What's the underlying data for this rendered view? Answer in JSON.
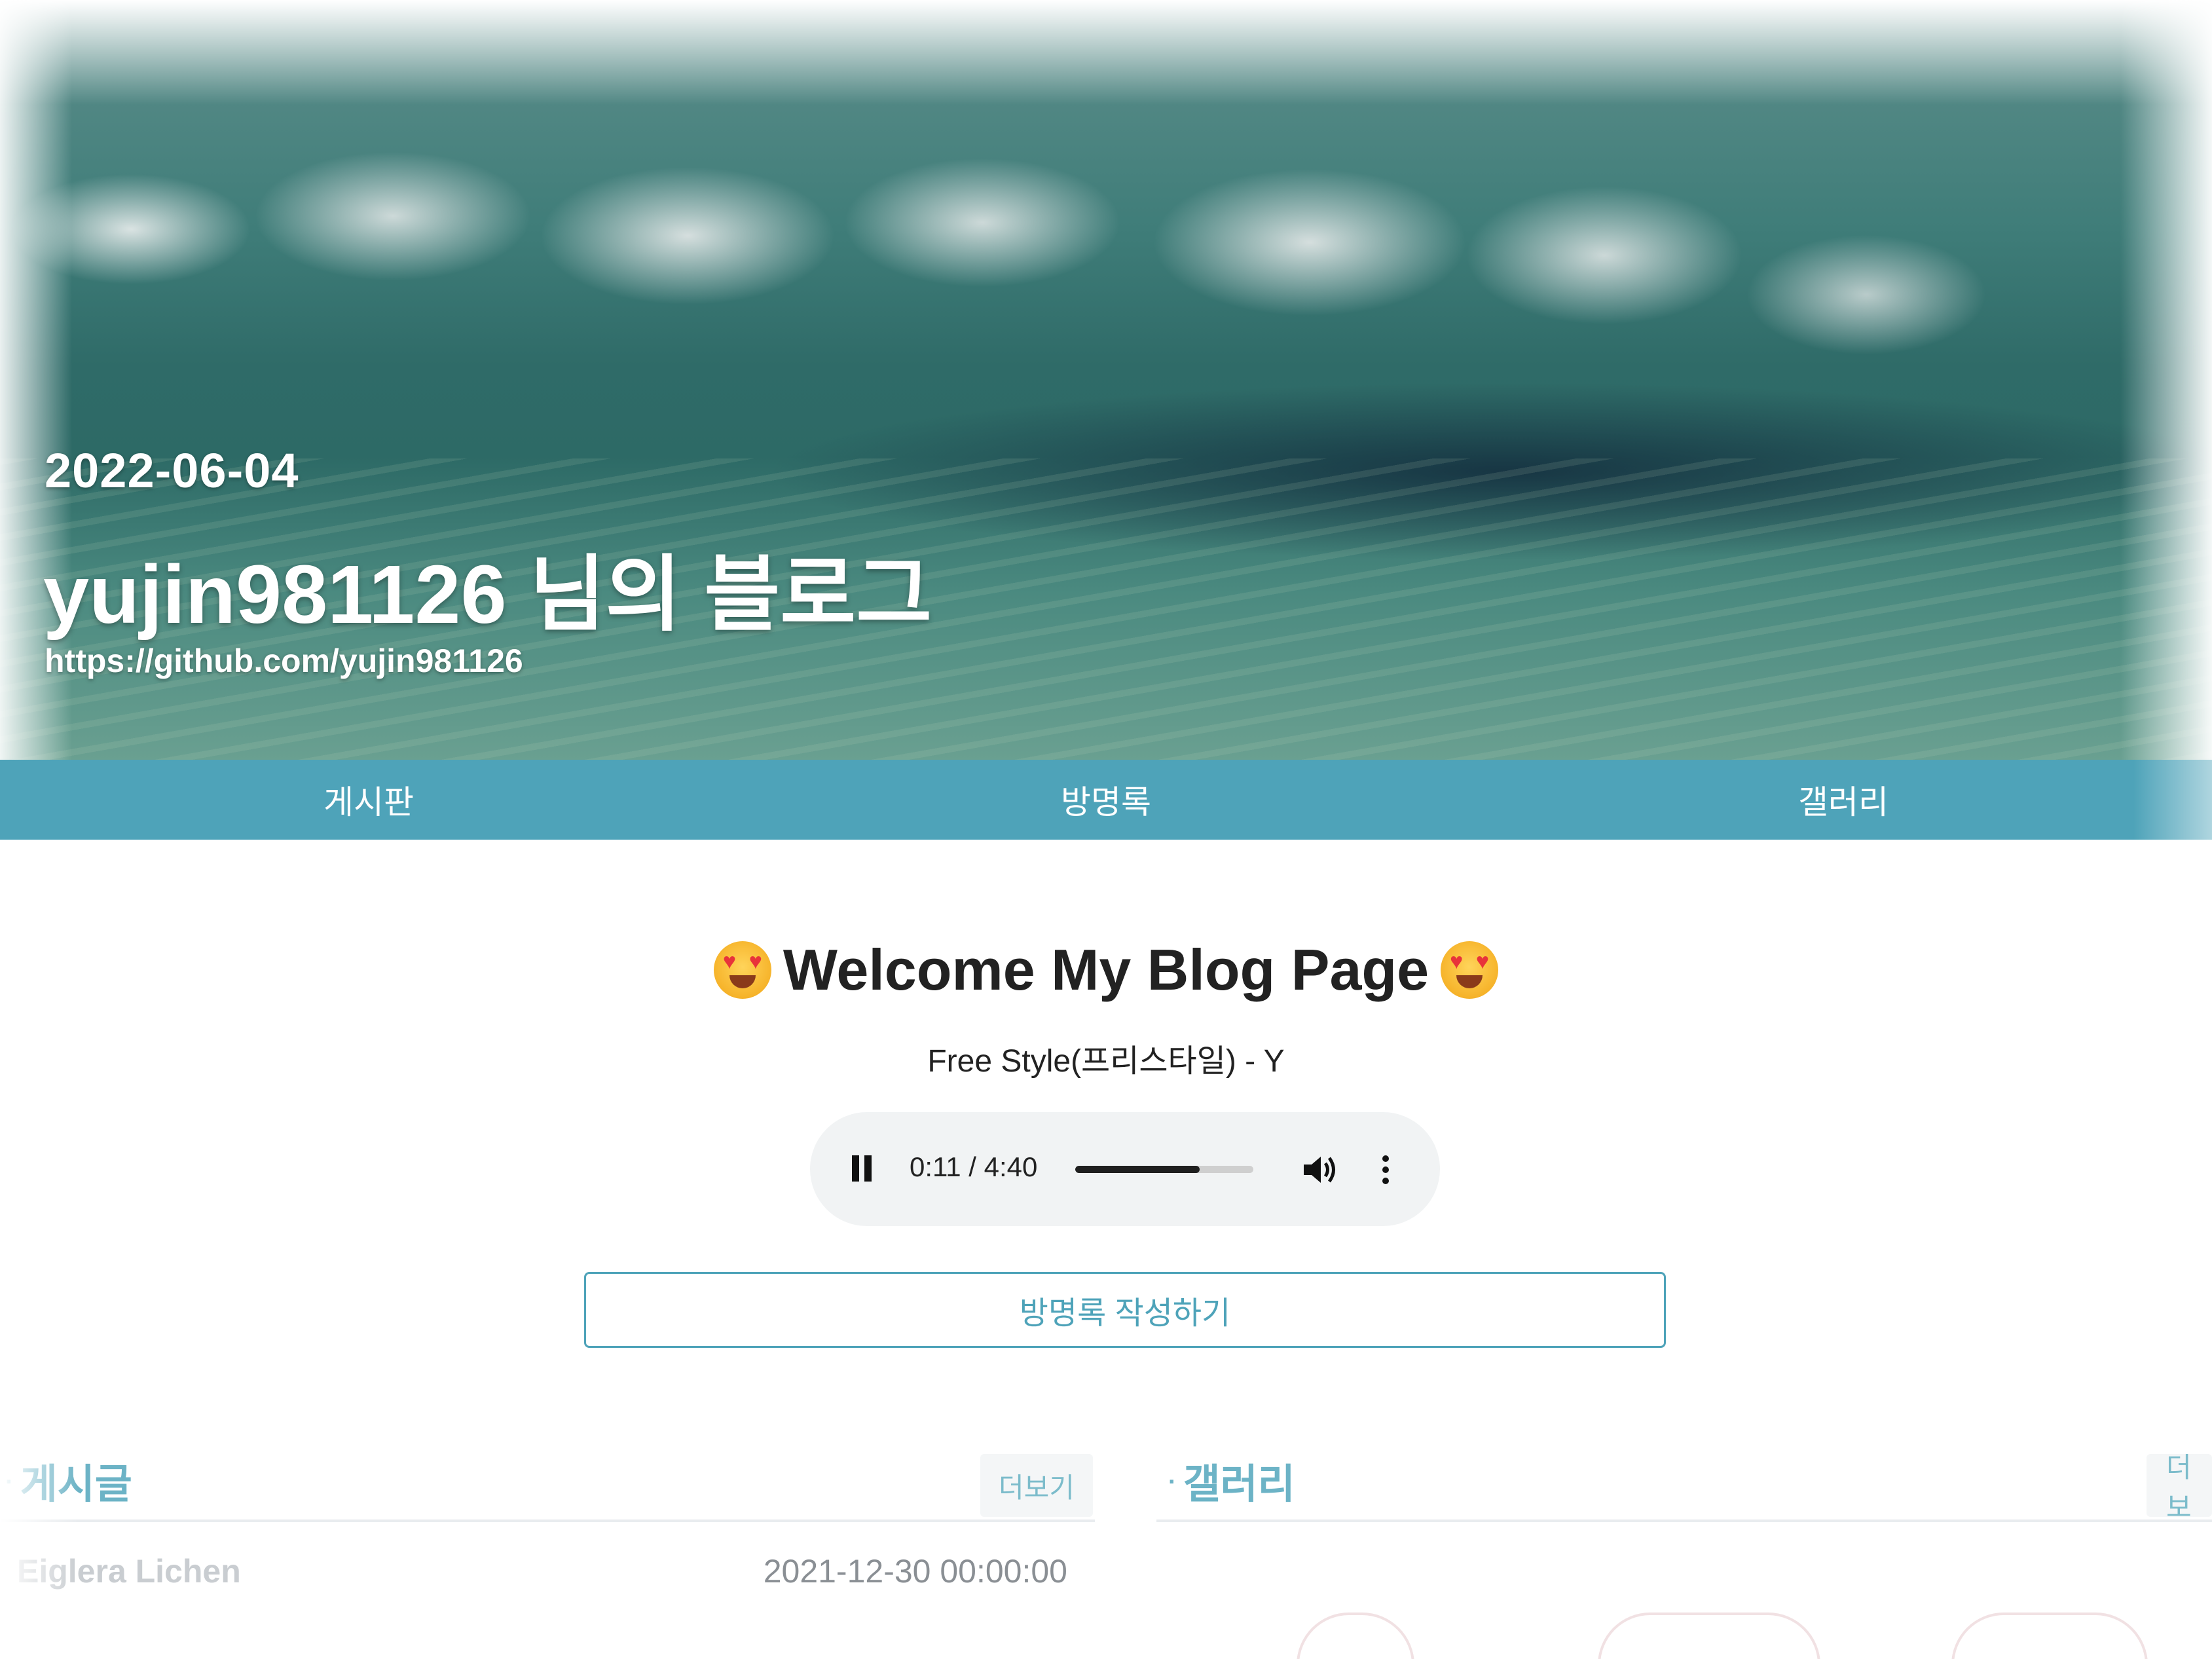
{
  "hero": {
    "date": "2022-06-04",
    "title": "yujin981126 님의 블로그",
    "url": "https://github.com/yujin981126"
  },
  "nav": {
    "items": [
      "게시판",
      "방명록",
      "갤러리"
    ]
  },
  "welcome": {
    "heading": "Welcome My Blog Page",
    "emoji": "heart-eyes-emoji",
    "song": "Free Style(프리스타일) - Y"
  },
  "player": {
    "time": "0:11 / 4:40",
    "progress_fraction": 0.7
  },
  "guestbook_button": "방명록 작성하기",
  "posts_section": {
    "dot": "·",
    "title": "게시글",
    "more": "더보기",
    "rows": [
      {
        "title": "Eiglera Lichen",
        "date": "2021-12-30 00:00:00"
      }
    ]
  },
  "gallery_section": {
    "dot": "·",
    "title": "갤러리",
    "more": "더보"
  },
  "colors": {
    "accent": "#4ea3b9",
    "section_title": "#6cb3c6",
    "nav_text": "#ffffff"
  }
}
